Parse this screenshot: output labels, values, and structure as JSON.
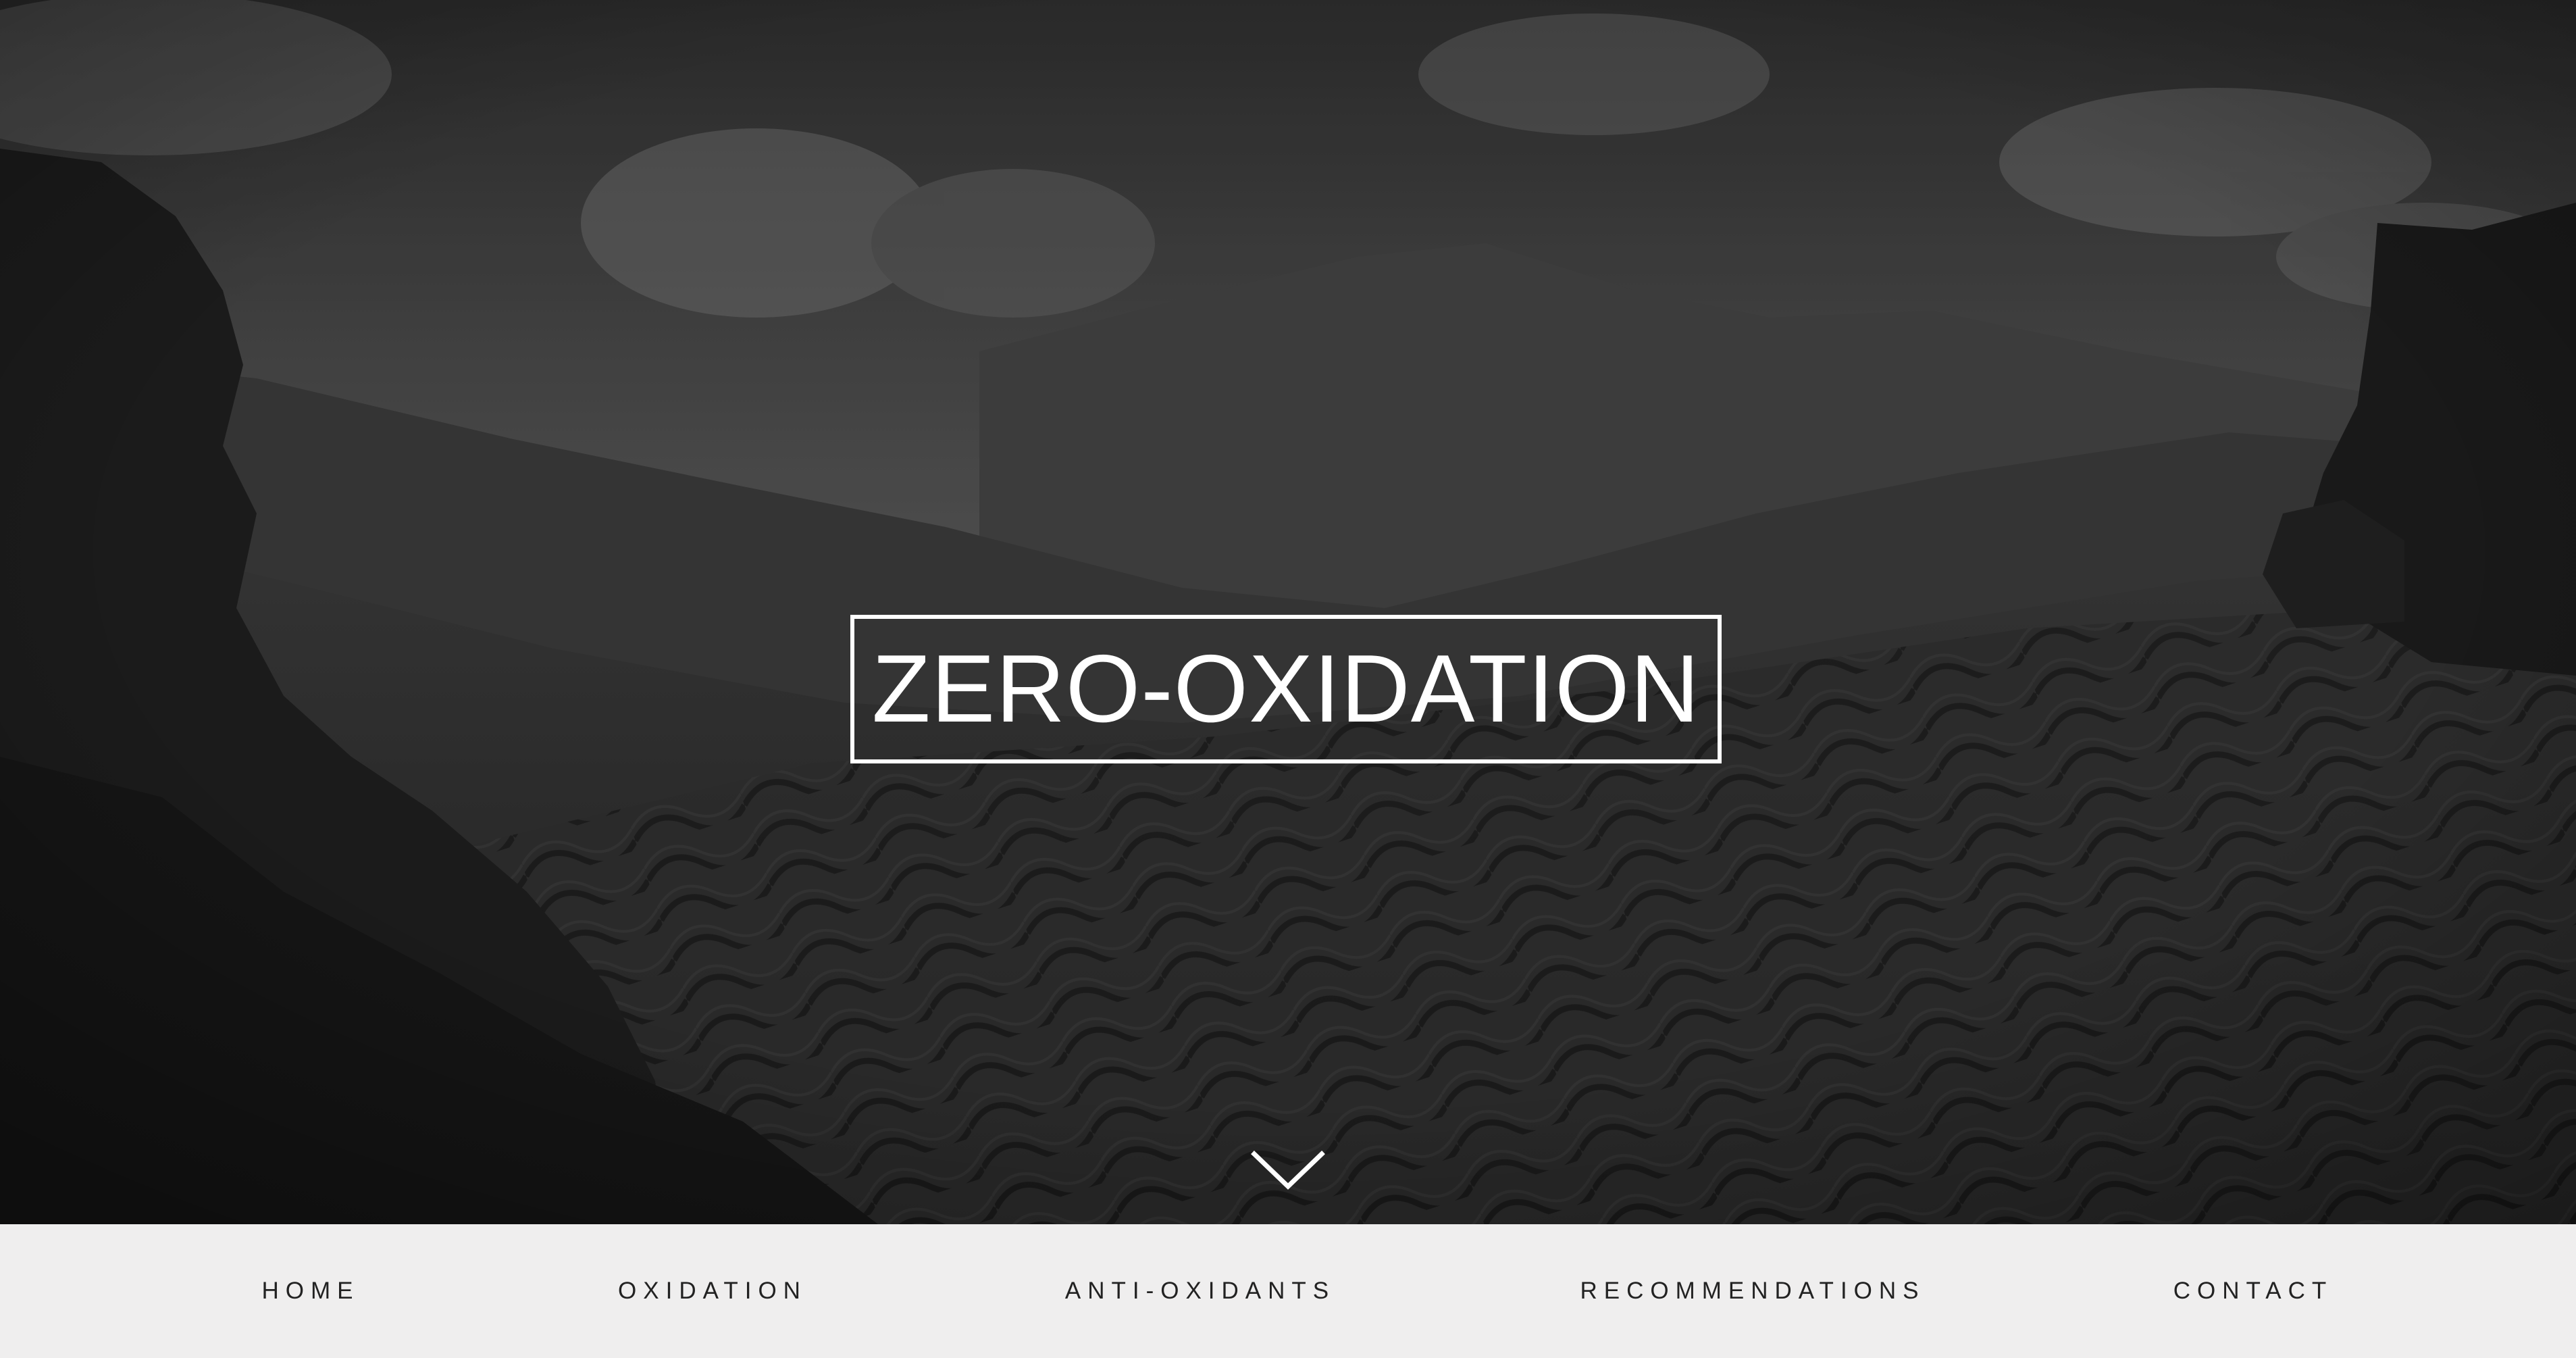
{
  "hero": {
    "title": "ZERO-OXIDATION",
    "scroll_icon": "chevron-down-icon",
    "background": "tea plantation hills, grayscale"
  },
  "nav": {
    "items": [
      {
        "label": "HOME"
      },
      {
        "label": "OXIDATION"
      },
      {
        "label": "ANTI-OXIDANTS"
      },
      {
        "label": "RECOMMENDATIONS"
      },
      {
        "label": "CONTACT"
      }
    ]
  },
  "colors": {
    "nav_background": "#efeeee",
    "nav_text": "#222222",
    "title_text": "#ffffff"
  }
}
